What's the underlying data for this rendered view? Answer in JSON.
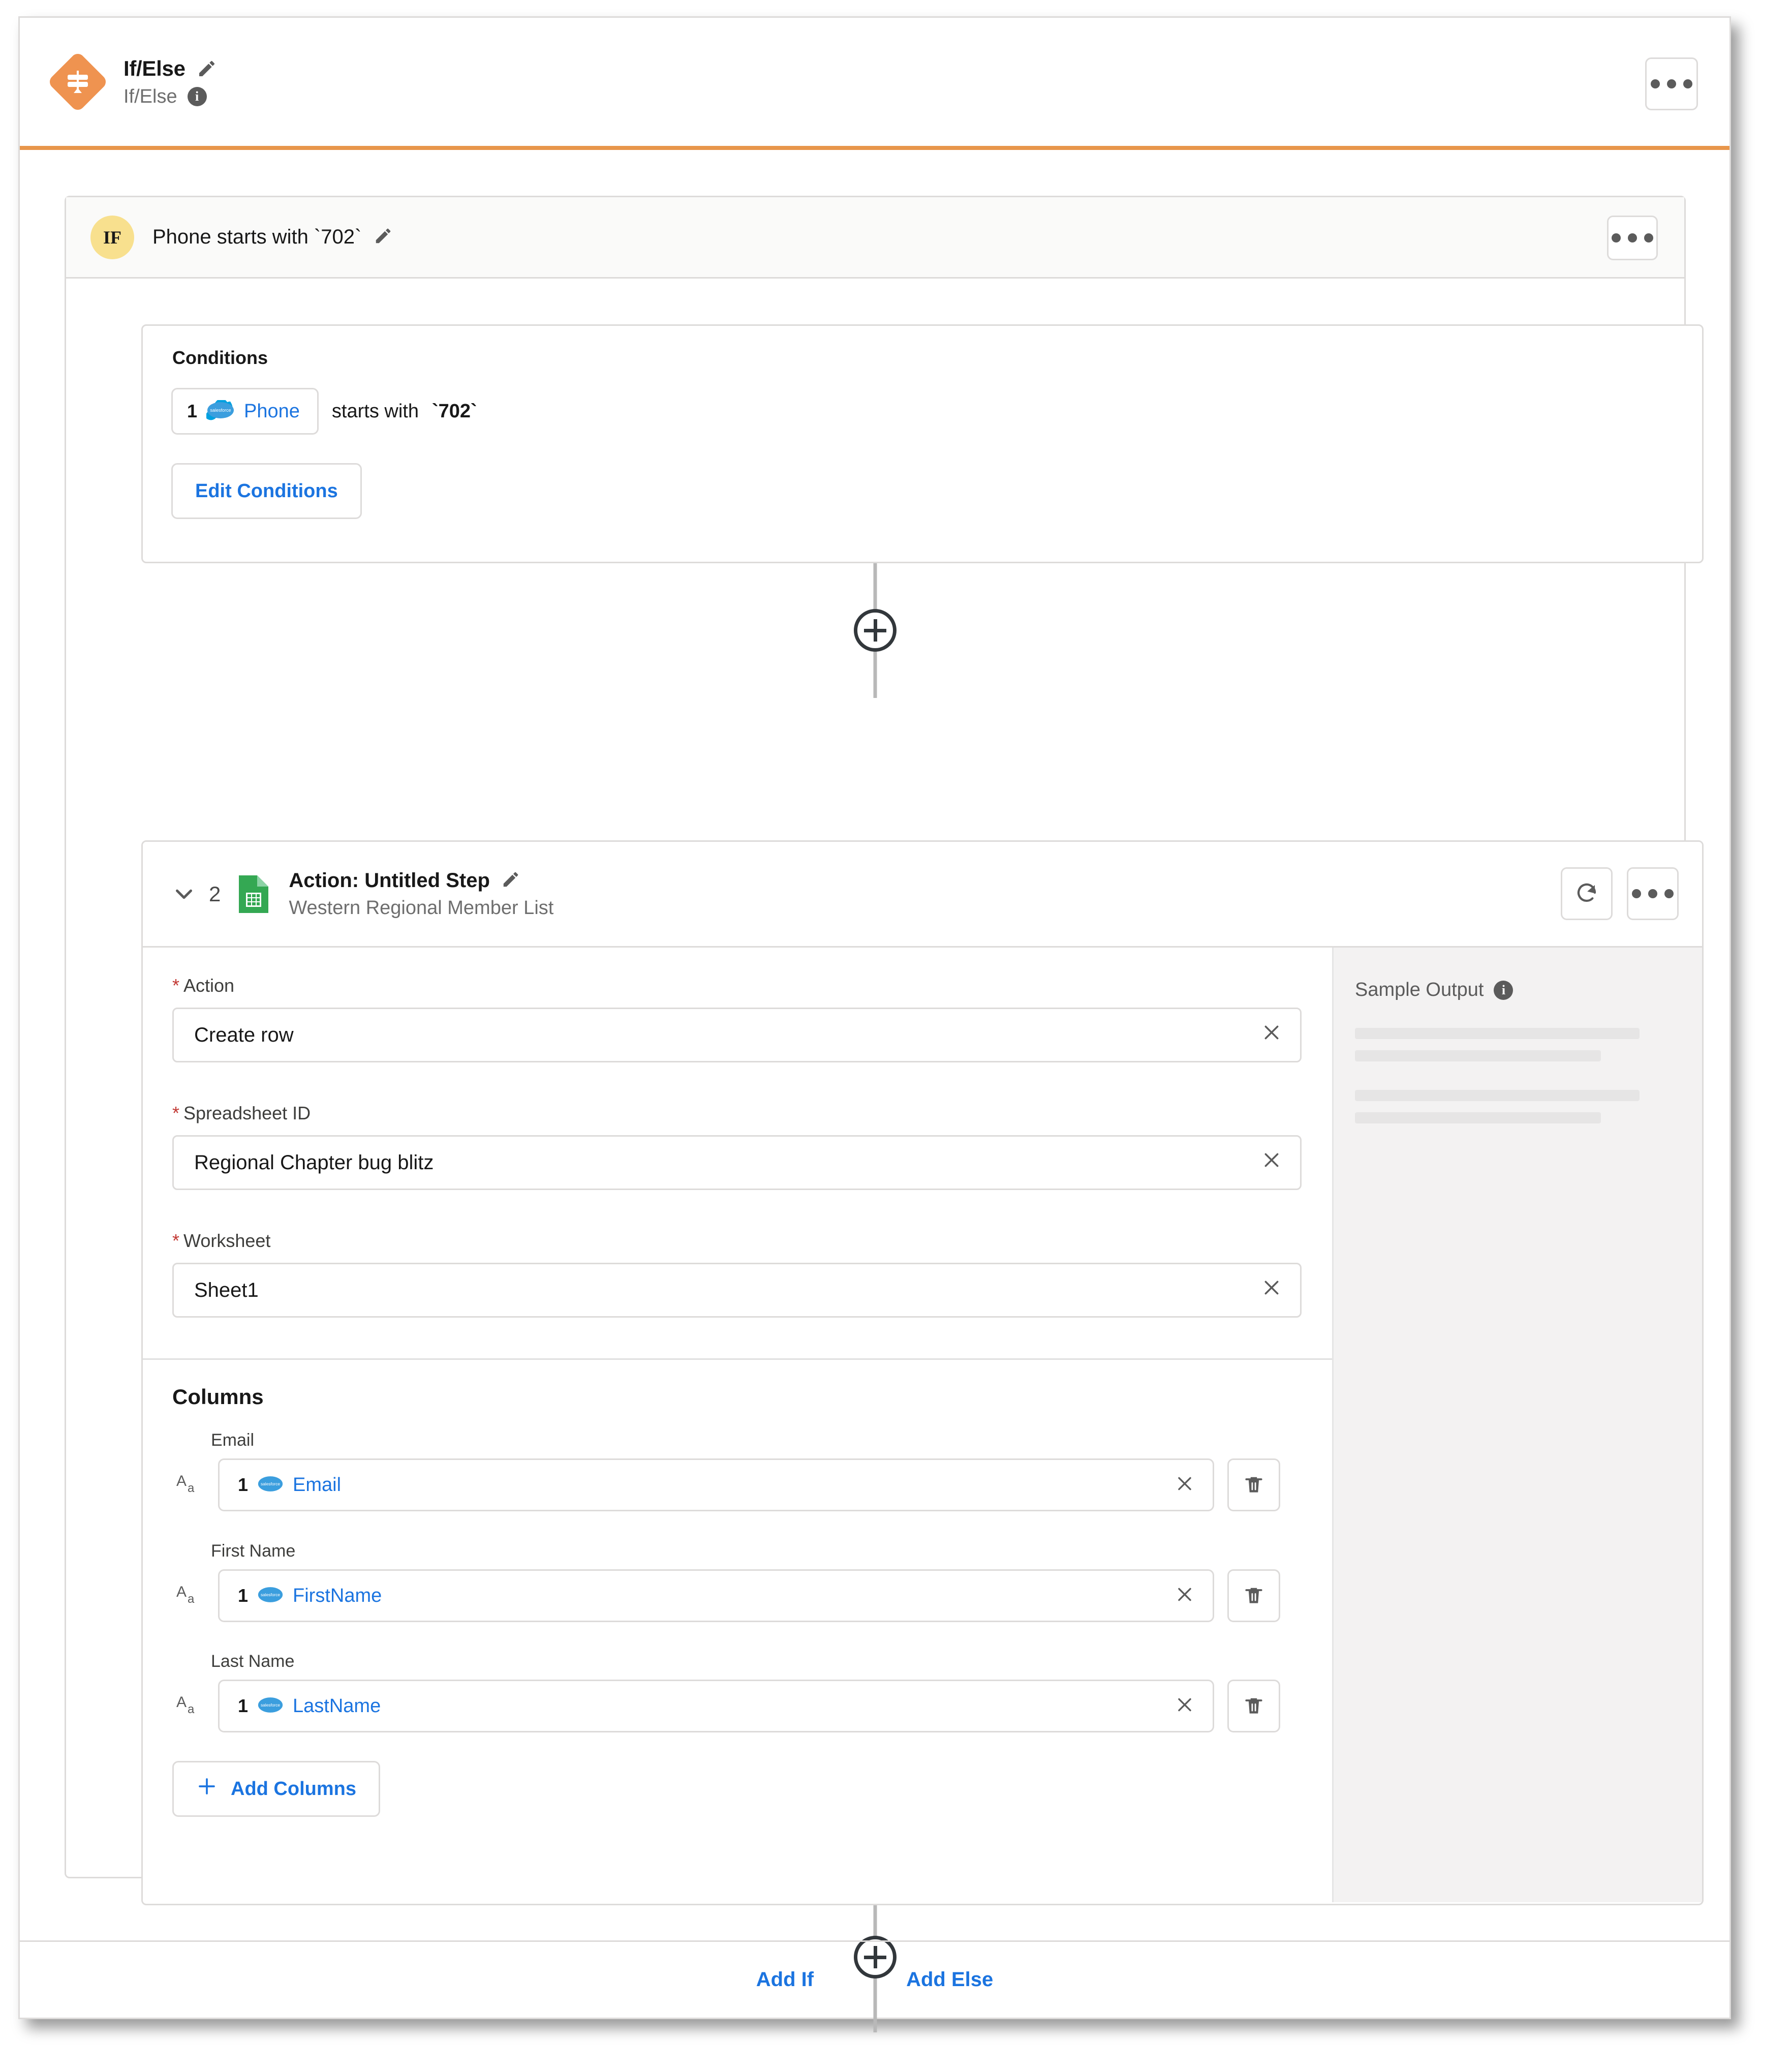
{
  "header": {
    "icon": "if-else-diamond-icon",
    "title": "If/Else",
    "subtitle": "If/Else",
    "edit_icon": "pencil-icon",
    "info_icon": "info-icon",
    "menu_icon": "kebab-menu-icon",
    "accent_color": "#e8964b"
  },
  "branch": {
    "badge": "IF",
    "badge_color": "#f8e08e",
    "label": "Phone starts with `702`",
    "edit_icon": "pencil-icon",
    "menu_icon": "kebab-menu-icon"
  },
  "conditions": {
    "title": "Conditions",
    "rows": [
      {
        "index": "1",
        "source_icon": "salesforce-cloud-icon",
        "field": "Phone",
        "operator": "starts with",
        "value": "`702`"
      }
    ],
    "edit_button": "Edit Conditions"
  },
  "connectors": [
    {
      "icon": "plus-circle-icon"
    },
    {
      "icon": "plus-circle-icon"
    }
  ],
  "action_step": {
    "collapse_icon": "chevron-down-icon",
    "number": "2",
    "app_icon": "google-sheets-icon",
    "title": "Action: Untitled Step",
    "edit_icon": "pencil-icon",
    "subtitle": "Western Regional Member List",
    "refresh_icon": "refresh-icon",
    "menu_icon": "kebab-menu-icon",
    "fields": [
      {
        "label": "Action",
        "required": true,
        "value": "Create row",
        "clear_icon": "close-icon"
      },
      {
        "label": "Spreadsheet ID",
        "required": true,
        "value": "Regional Chapter bug blitz",
        "clear_icon": "close-icon"
      },
      {
        "label": "Worksheet",
        "required": true,
        "value": "Sheet1",
        "clear_icon": "close-icon"
      }
    ],
    "columns_section": {
      "title": "Columns",
      "items": [
        {
          "label": "Email",
          "type_icon": "text-type-icon",
          "index": "1",
          "source_icon": "salesforce-cloud-icon",
          "token": "Email",
          "clear_icon": "close-icon",
          "delete_icon": "trash-icon"
        },
        {
          "label": "First Name",
          "type_icon": "text-type-icon",
          "index": "1",
          "source_icon": "salesforce-cloud-icon",
          "token": "FirstName",
          "clear_icon": "close-icon",
          "delete_icon": "trash-icon"
        },
        {
          "label": "Last Name",
          "type_icon": "text-type-icon",
          "index": "1",
          "source_icon": "salesforce-cloud-icon",
          "token": "LastName",
          "clear_icon": "close-icon",
          "delete_icon": "trash-icon"
        }
      ],
      "add_button": "Add Columns",
      "add_icon": "plus-icon"
    },
    "sample_output": {
      "title": "Sample Output",
      "info_icon": "info-icon"
    }
  },
  "footer": {
    "add_if": "Add If",
    "add_else": "Add Else"
  }
}
